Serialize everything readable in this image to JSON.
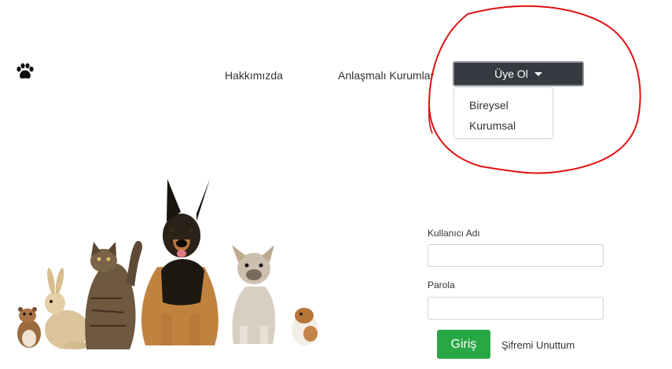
{
  "brand": {
    "logo_icon": "paw-icon"
  },
  "nav": {
    "about": "Hakkımızda",
    "partners": "Anlaşmalı Kurumlar",
    "signup_label": "Üye Ol",
    "dropdown_items": [
      "Bireysel",
      "Kurumsal"
    ]
  },
  "login": {
    "username_label": "Kullanıcı Adı",
    "username_value": "",
    "password_label": "Parola",
    "password_value": "",
    "submit_label": "Giriş",
    "forgot_label": "Şifremi Unuttum"
  },
  "colors": {
    "signup_bg": "#343a40",
    "login_button": "#28a745",
    "annotation_circle": "#e01010"
  }
}
